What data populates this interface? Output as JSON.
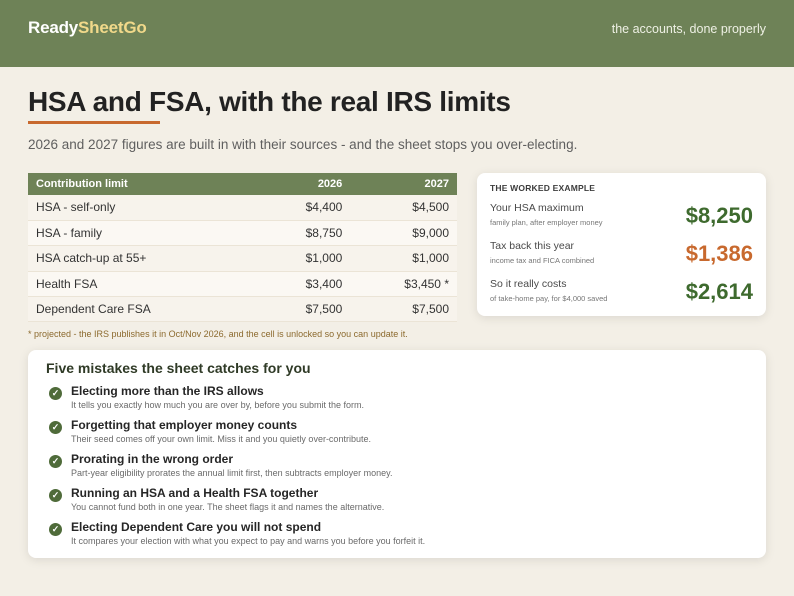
{
  "brand": {
    "name_part1": "Ready",
    "name_part2": "SheetGo",
    "tagline": "the accounts, done properly"
  },
  "hero": {
    "title": "HSA and FSA, with the real IRS limits",
    "subtitle": "2026 and 2027 figures are built in with their sources - and the sheet stops you over-electing."
  },
  "limits_table": {
    "headers": [
      "Contribution limit",
      "2026",
      "2027"
    ],
    "rows": [
      [
        "HSA - self-only",
        "$4,400",
        "$4,500"
      ],
      [
        "HSA - family",
        "$8,750",
        "$9,000"
      ],
      [
        "HSA catch-up at 55+",
        "$1,000",
        "$1,000"
      ],
      [
        "Health FSA",
        "$3,400",
        "$3,450 *"
      ],
      [
        "Dependent Care FSA",
        "$7,500",
        "$7,500"
      ]
    ],
    "footnote": "* projected - the IRS publishes it in Oct/Nov 2026, and the cell is unlocked so you can update it."
  },
  "example": {
    "heading": "THE WORKED EXAMPLE",
    "rows": [
      {
        "label": "Your HSA maximum",
        "note": "family plan, after employer money",
        "value": "$8,250",
        "color": "#3e6a2e"
      },
      {
        "label": "Tax back this year",
        "note": "income tax and FICA combined",
        "value": "$1,386",
        "color": "#c8692e"
      },
      {
        "label": "So it really costs",
        "note": "of take-home pay, for $4,000 saved",
        "value": "$2,614",
        "color": "#3e6a2e"
      }
    ]
  },
  "mistakes": {
    "title": "Five mistakes the sheet catches for you",
    "items": [
      {
        "title": "Electing more than the IRS allows",
        "desc": "It tells you exactly how much you are over by, before you submit the form."
      },
      {
        "title": "Forgetting that employer money counts",
        "desc": "Their seed comes off your own limit. Miss it and you quietly over-contribute."
      },
      {
        "title": "Prorating in the wrong order",
        "desc": "Part-year eligibility prorates the annual limit first, then subtracts employer money."
      },
      {
        "title": "Running an HSA and a Health FSA together",
        "desc": "You cannot fund both in one year. The sheet flags it and names the alternative."
      },
      {
        "title": "Electing Dependent Care you will not spend",
        "desc": "It compares your election with what you expect to pay and warns you before you forfeit it."
      }
    ]
  },
  "colors": {
    "brand_green": "#6e8257",
    "accent_orange": "#c8692e",
    "projected_gold": "#b4862d",
    "page_bg": "#f3efe6"
  }
}
